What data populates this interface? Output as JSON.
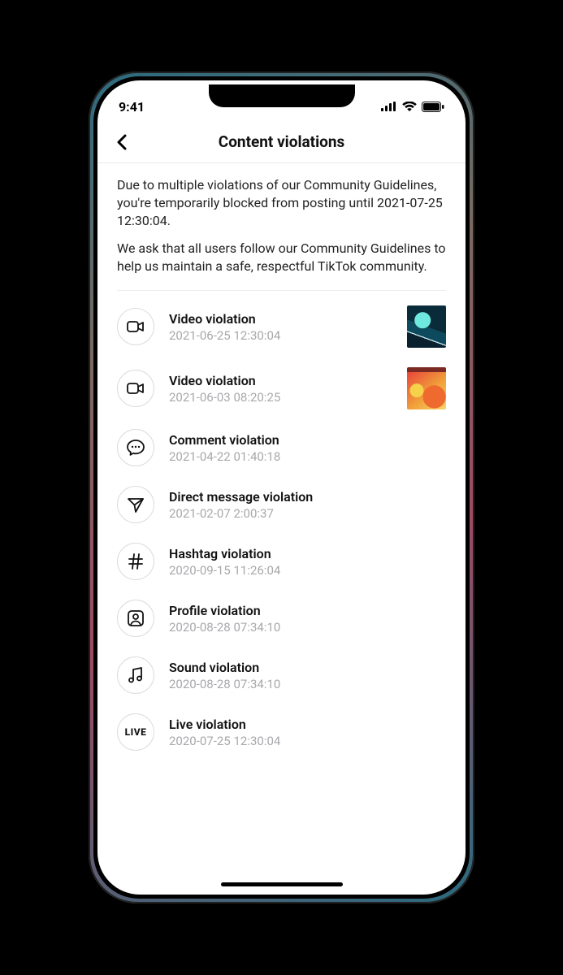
{
  "status": {
    "time": "9:41"
  },
  "nav": {
    "title": "Content violations"
  },
  "intro": {
    "p1": "Due to multiple violations of our Community Guidelines, you're temporarily blocked from posting until 2021-07-25 12:30:04.",
    "p2": "We ask that all users follow our Community Guidelines to help us maintain a safe, respectful TikTok community."
  },
  "violations": [
    {
      "icon": "video",
      "title": "Video violation",
      "time": "2021-06-25 12:30:04",
      "thumb": "t0"
    },
    {
      "icon": "video",
      "title": "Video violation",
      "time": "2021-06-03 08:20:25",
      "thumb": "t1"
    },
    {
      "icon": "comment",
      "title": "Comment violation",
      "time": "2021-04-22 01:40:18"
    },
    {
      "icon": "send",
      "title": "Direct message violation",
      "time": "2021-02-07 2:00:37"
    },
    {
      "icon": "hashtag",
      "title": "Hashtag violation",
      "time": "2020-09-15 11:26:04"
    },
    {
      "icon": "profile",
      "title": "Profile violation",
      "time": "2020-08-28 07:34:10"
    },
    {
      "icon": "sound",
      "title": "Sound violation",
      "time": "2020-08-28 07:34:10"
    },
    {
      "icon": "live",
      "title": "Live violation",
      "time": "2020-07-25 12:30:04"
    }
  ]
}
